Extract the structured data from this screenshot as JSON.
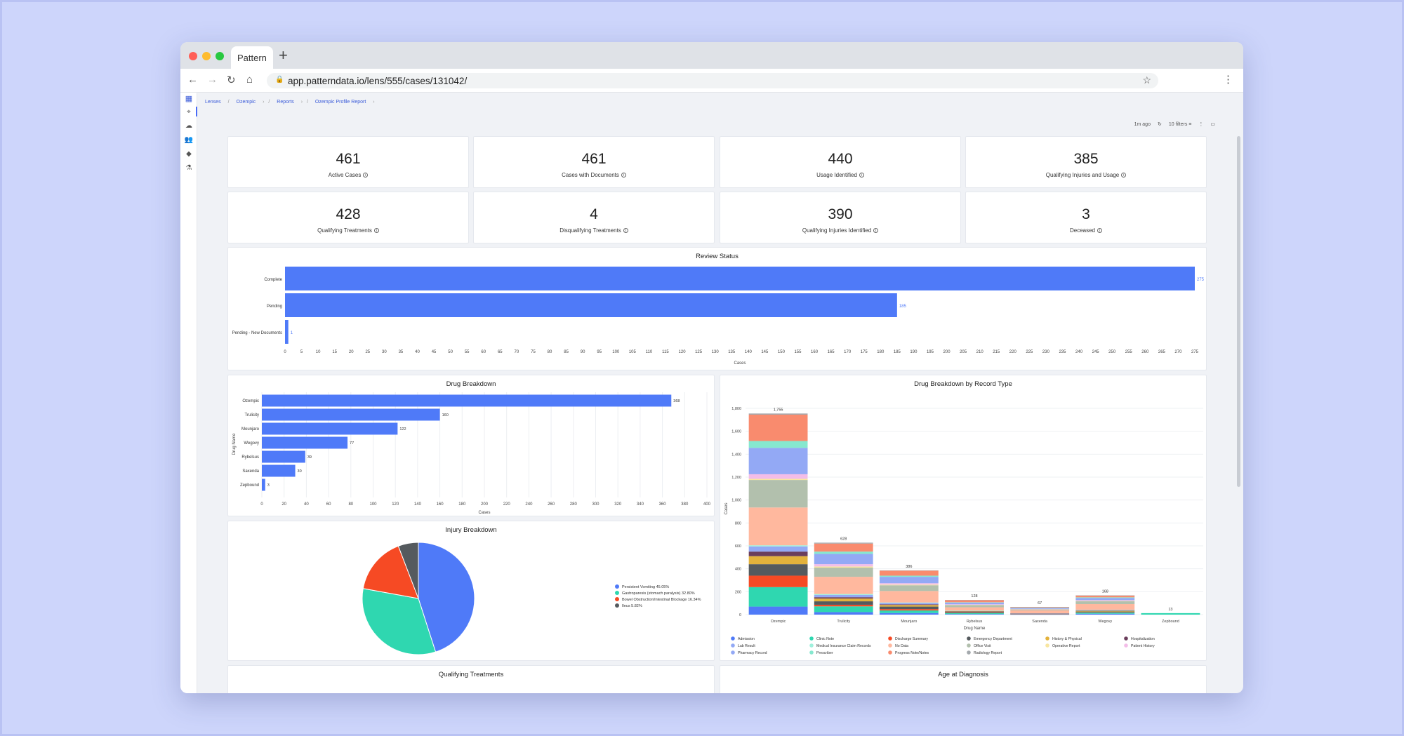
{
  "browser": {
    "tab_title": "Pattern",
    "url": "app.patterndata.io/lens/555/cases/131042/"
  },
  "breadcrumbs": [
    "Lenses",
    "Ozempic",
    "Reports",
    "Ozempic Profile Report"
  ],
  "toolbar": {
    "updated": "1m ago",
    "filters": "10 filters"
  },
  "kpis": [
    {
      "value": "461",
      "label": "Active Cases"
    },
    {
      "value": "461",
      "label": "Cases with Documents"
    },
    {
      "value": "440",
      "label": "Usage Identified"
    },
    {
      "value": "385",
      "label": "Qualifying Injuries and Usage"
    },
    {
      "value": "428",
      "label": "Qualifying Treatments"
    },
    {
      "value": "4",
      "label": "Disqualifying Treatments"
    },
    {
      "value": "390",
      "label": "Qualifying Injuries Identified"
    },
    {
      "value": "3",
      "label": "Deceased"
    }
  ],
  "colors": {
    "bar": "#4f7af8",
    "pie": [
      "#4f7af8",
      "#2fd7b0",
      "#f64a24",
      "#555a5e"
    ],
    "record_types": {
      "Admission": "#4f7af8",
      "Clinic Note": "#2fd7b0",
      "Discharge Summary": "#f64a24",
      "Emergency Department": "#555a5e",
      "History & Physical": "#e3b23c",
      "Hospitalization": "#6b3e5c",
      "Lab Result": "#93a9f5",
      "Medical Insurance Claim Records": "#9ff0dc",
      "No Data": "#ffb89e",
      "Office Visit": "#b2c0ad",
      "Operative Report": "#f8e6a0",
      "Patient History": "#f3bde8",
      "Pharmacy Record": "#93a9f5",
      "Prescriber": "#86e8cf",
      "Progress Note/Notes": "#f98b6e",
      "Radiology Report": "#a4a9ad"
    }
  },
  "chart_data": [
    {
      "type": "bar",
      "title": "Review Status",
      "orientation": "horizontal",
      "categories": [
        "Complete",
        "Pending",
        "Pending - New Documents"
      ],
      "values": [
        275,
        185,
        1
      ],
      "xlabel": "Cases",
      "xlim": [
        0,
        275
      ],
      "xticks": [
        0,
        5,
        10,
        15,
        20,
        25,
        30,
        35,
        40,
        45,
        50,
        55,
        60,
        65,
        70,
        75,
        80,
        85,
        90,
        95,
        100,
        105,
        110,
        115,
        120,
        125,
        130,
        135,
        140,
        145,
        150,
        155,
        160,
        165,
        170,
        175,
        180,
        185,
        190,
        195,
        200,
        205,
        210,
        215,
        220,
        225,
        230,
        235,
        240,
        245,
        250,
        255,
        260,
        265,
        270,
        275
      ]
    },
    {
      "type": "bar",
      "title": "Drug Breakdown",
      "orientation": "horizontal",
      "categories": [
        "Ozempic",
        "Trulicity",
        "Mounjaro",
        "Wegovy",
        "Rybelsus",
        "Saxenda",
        "Zepbound"
      ],
      "values": [
        368,
        160,
        122,
        77,
        39,
        30,
        3
      ],
      "xlabel": "Cases",
      "ylabel": "Drug Name",
      "xlim": [
        0,
        400
      ],
      "xticks": [
        0,
        20,
        40,
        60,
        80,
        100,
        120,
        140,
        160,
        180,
        200,
        220,
        240,
        260,
        280,
        300,
        320,
        340,
        360,
        380,
        400
      ]
    },
    {
      "type": "pie",
      "title": "Injury Breakdown",
      "labels": [
        "Persistent Vomiting 45.05%",
        "Gastroparesis (stomach paralysis) 32.80%",
        "Bowel Obstruction/Intestinal Blockage 16.34%",
        "Ileus 5.82%"
      ],
      "values": [
        45.05,
        32.8,
        16.34,
        5.82
      ],
      "legend": "right"
    },
    {
      "type": "bar",
      "stacked": true,
      "title": "Drug Breakdown by Record Type",
      "xlabel": "Drug Name",
      "ylabel": "Cases",
      "ylim": [
        0,
        1800
      ],
      "yticks": [
        0,
        200,
        400,
        600,
        800,
        "1,000",
        "1,200",
        "1,400",
        "1,600",
        "1,800"
      ],
      "categories": [
        "Ozempic",
        "Trulicity",
        "Mounjaro",
        "Rybelsus",
        "Saxenda",
        "Wegovy",
        "Zepbound"
      ],
      "totals": [
        "1,755",
        "628",
        "386",
        "128",
        "67",
        "168",
        "13"
      ],
      "total_values": [
        1755,
        628,
        386,
        128,
        67,
        168,
        13
      ],
      "legend_items": [
        "Admission",
        "Clinic Note",
        "Discharge Summary",
        "Emergency Department",
        "History & Physical",
        "Hospitalization",
        "Lab Result",
        "Medical Insurance Claim Records",
        "No Data",
        "Office Visit",
        "Operative Report",
        "Patient History",
        "Pharmacy Record",
        "Prescriber",
        "Progress Note/Notes",
        "Radiology Report"
      ],
      "series": [
        {
          "name": "Admission",
          "values": [
            70,
            22,
            14,
            5,
            2,
            8,
            0
          ]
        },
        {
          "name": "Clinic Note",
          "values": [
            170,
            50,
            22,
            8,
            3,
            10,
            13
          ]
        },
        {
          "name": "Discharge Summary",
          "values": [
            100,
            14,
            12,
            3,
            1,
            3,
            0
          ]
        },
        {
          "name": "Emergency Department",
          "values": [
            100,
            30,
            22,
            8,
            2,
            6,
            0
          ]
        },
        {
          "name": "History & Physical",
          "values": [
            70,
            24,
            14,
            4,
            2,
            6,
            0
          ]
        },
        {
          "name": "Hospitalization",
          "values": [
            40,
            12,
            6,
            2,
            1,
            3,
            0
          ]
        },
        {
          "name": "Lab Result",
          "values": [
            45,
            20,
            12,
            3,
            1,
            4,
            0
          ]
        },
        {
          "name": "Medical Insurance Claim Records",
          "values": [
            10,
            8,
            4,
            1,
            0,
            2,
            0
          ]
        },
        {
          "name": "No Data",
          "values": [
            330,
            150,
            100,
            30,
            25,
            50,
            0
          ]
        },
        {
          "name": "Office Visit",
          "values": [
            240,
            80,
            50,
            20,
            10,
            25,
            0
          ]
        },
        {
          "name": "Operative Report",
          "values": [
            10,
            10,
            6,
            2,
            1,
            3,
            0
          ]
        },
        {
          "name": "Patient History",
          "values": [
            40,
            20,
            12,
            4,
            2,
            6,
            0
          ]
        },
        {
          "name": "Pharmacy Record",
          "values": [
            230,
            90,
            56,
            15,
            8,
            20,
            0
          ]
        },
        {
          "name": "Prescriber",
          "values": [
            60,
            20,
            10,
            3,
            2,
            5,
            0
          ]
        },
        {
          "name": "Progress Note/Notes",
          "values": [
            230,
            70,
            44,
            18,
            6,
            15,
            0
          ]
        },
        {
          "name": "Radiology Report",
          "values": [
            10,
            8,
            2,
            2,
            1,
            2,
            0
          ]
        }
      ]
    },
    {
      "type": "bar",
      "title": "Qualifying Treatments"
    },
    {
      "type": "bar",
      "title": "Age at Diagnosis"
    }
  ]
}
